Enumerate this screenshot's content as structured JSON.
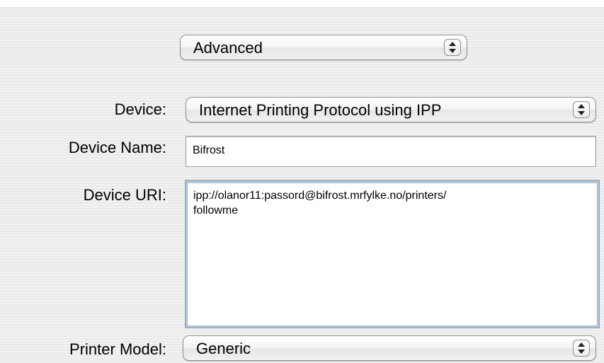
{
  "mode_popup": {
    "value": "Advanced"
  },
  "device": {
    "label": "Device:",
    "value": "Internet Printing Protocol using IPP"
  },
  "device_name": {
    "label": "Device Name:",
    "value": "Bifrost"
  },
  "device_uri": {
    "label": "Device URI:",
    "value": "ipp://olanor11:passord@bifrost.mrfylke.no/printers/\nfollowme"
  },
  "printer_model": {
    "label": "Printer Model:",
    "value": "Generic"
  },
  "icons": [
    "popup-stepper-icon"
  ]
}
